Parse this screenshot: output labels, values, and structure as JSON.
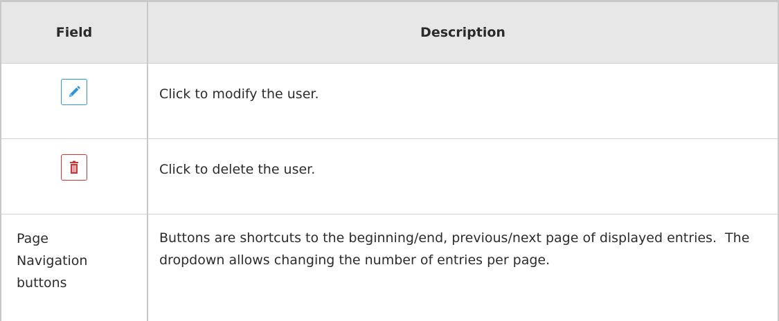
{
  "table": {
    "headers": {
      "field": "Field",
      "description": "Description"
    },
    "rows": [
      {
        "field_icon": "pencil-icon",
        "description": "Click to modify the user."
      },
      {
        "field_icon": "trash-icon",
        "description": "Click to delete the user."
      },
      {
        "field_lines": [
          "Page",
          "Navigation",
          "buttons"
        ],
        "description": "Buttons are shortcuts to the beginning/end, previous/next page of displayed entries.  The dropdown allows changing the number of entries per page."
      }
    ]
  },
  "colors": {
    "edit_accent": "#2a95d8",
    "delete_accent": "#d23131",
    "header_bg": "#e7e7e7"
  }
}
